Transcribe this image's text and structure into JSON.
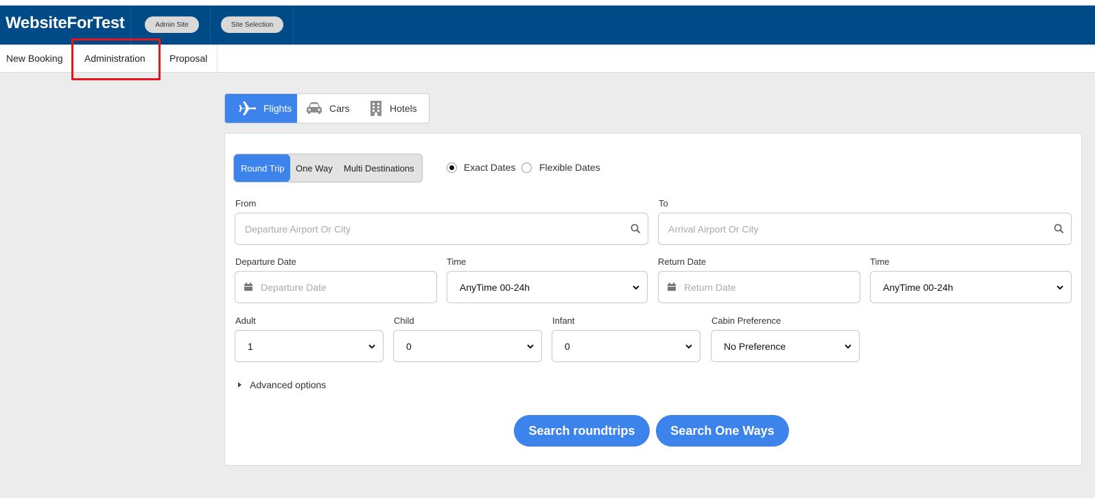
{
  "header": {
    "brand": "WebsiteForTest",
    "admin_site_label": "Admin Site",
    "site_selection_label": "Site Selection"
  },
  "nav": {
    "items": [
      {
        "label": "New Booking"
      },
      {
        "label": "Administration"
      },
      {
        "label": "Proposal"
      }
    ]
  },
  "product_tabs": [
    {
      "label": "Flights",
      "icon": "plane-icon",
      "active": true
    },
    {
      "label": "Cars",
      "icon": "car-icon",
      "active": false
    },
    {
      "label": "Hotels",
      "icon": "building-icon",
      "active": false
    }
  ],
  "trip_type": {
    "options": [
      "Round Trip",
      "One Way",
      "Multi Destinations"
    ],
    "selected": "Round Trip"
  },
  "date_mode": {
    "exact_label": "Exact Dates",
    "flexible_label": "Flexible Dates",
    "selected": "Exact Dates"
  },
  "form": {
    "from": {
      "label": "From",
      "placeholder": "Departure Airport Or City"
    },
    "to": {
      "label": "To",
      "placeholder": "Arrival Airport Or City"
    },
    "departure_date": {
      "label": "Departure Date",
      "placeholder": "Departure Date"
    },
    "departure_time": {
      "label": "Time",
      "value": "AnyTime 00-24h"
    },
    "return_date": {
      "label": "Return Date",
      "placeholder": "Return Date"
    },
    "return_time": {
      "label": "Time",
      "value": "AnyTime 00-24h"
    },
    "adult": {
      "label": "Adult",
      "value": "1"
    },
    "child": {
      "label": "Child",
      "value": "0"
    },
    "infant": {
      "label": "Infant",
      "value": "0"
    },
    "cabin": {
      "label": "Cabin Preference",
      "value": "No Preference"
    },
    "advanced_label": "Advanced options"
  },
  "actions": {
    "search_roundtrips": "Search roundtrips",
    "search_one_ways": "Search One Ways"
  },
  "colors": {
    "header_bg": "#004a87",
    "accent": "#3d83ec",
    "highlight": "#e8141b",
    "page_bg": "#ececec"
  }
}
